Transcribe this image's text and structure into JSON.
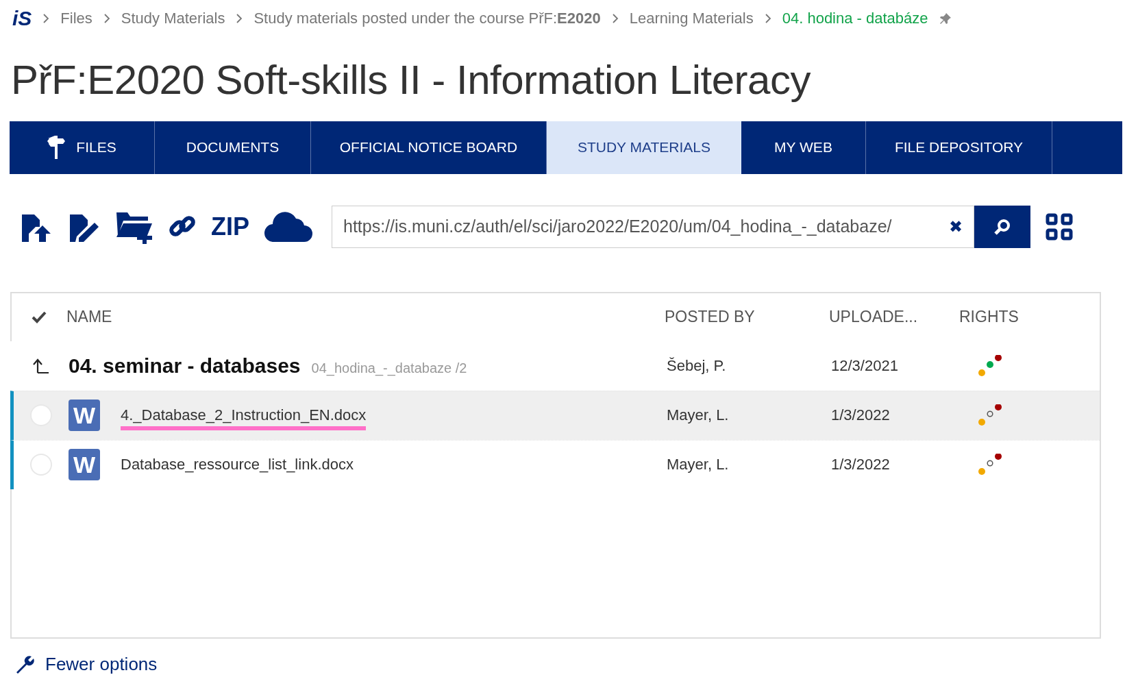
{
  "breadcrumb": [
    {
      "label": "Files",
      "current": false
    },
    {
      "label": "Study Materials",
      "current": false
    },
    {
      "label": "Study materials posted under the course PřF:**E2020**",
      "current": false
    },
    {
      "label": "Learning Materials",
      "current": false
    },
    {
      "label": "04. hodina - databáze",
      "current": true
    }
  ],
  "logo": "iS",
  "page_title": "PřF:E2020 Soft-skills II - Information Literacy",
  "tabs": [
    {
      "label": "FILES",
      "selected": false,
      "kind": "icon"
    },
    {
      "label": "DOCUMENTS",
      "selected": false,
      "kind": "plain"
    },
    {
      "label": "OFFICIAL NOTICE BOARD",
      "selected": false,
      "kind": "plain"
    },
    {
      "label": "STUDY MATERIALS",
      "selected": true,
      "kind": "plain"
    },
    {
      "label": "MY WEB",
      "selected": false,
      "kind": "plain"
    },
    {
      "label": "FILE DEPOSITORY",
      "selected": false,
      "kind": "plain"
    }
  ],
  "toolbar": {
    "zip_label": "ZIP",
    "path_field": {
      "value": "https://is.muni.cz/auth/el/sci/jaro2022/E2020/um/04_hodina_-_databaze/",
      "clear": "✖"
    }
  },
  "table": {
    "columns": [
      "NAME",
      "POSTED BY",
      "UPLOADE...",
      "RIGHTS"
    ],
    "folder": {
      "title": "04. seminar - databases",
      "path": "04_hodina_-_databaze /2",
      "posted_by": "Šebej, P.",
      "uploaded": "12/3/2021",
      "rights": [
        {
          "kind": "filled",
          "color": "#f2a900"
        },
        {
          "kind": "filled",
          "color": "#00a94f"
        },
        {
          "kind": "filled",
          "color": "#a50000"
        }
      ]
    },
    "rows": [
      {
        "icon": "W",
        "name": "4._Database_2_Instruction_EN.docx",
        "posted_by": "Mayer, L.",
        "uploaded": "1/3/2022",
        "checked": false,
        "highlighted": true,
        "underlined": true,
        "rights": [
          {
            "kind": "filled",
            "color": "#f2a900"
          },
          {
            "kind": "outline",
            "color": "#555555"
          },
          {
            "kind": "filled",
            "color": "#a50000"
          }
        ]
      },
      {
        "icon": "W",
        "name": "Database_ressource_list_link.docx",
        "posted_by": "Mayer, L.",
        "uploaded": "1/3/2022",
        "checked": false,
        "highlighted": false,
        "underlined": false,
        "rights": [
          {
            "kind": "filled",
            "color": "#f2a900"
          },
          {
            "kind": "outline",
            "color": "#555555"
          },
          {
            "kind": "filled",
            "color": "#a50000"
          }
        ]
      }
    ]
  },
  "footer_link": "Fewer options"
}
